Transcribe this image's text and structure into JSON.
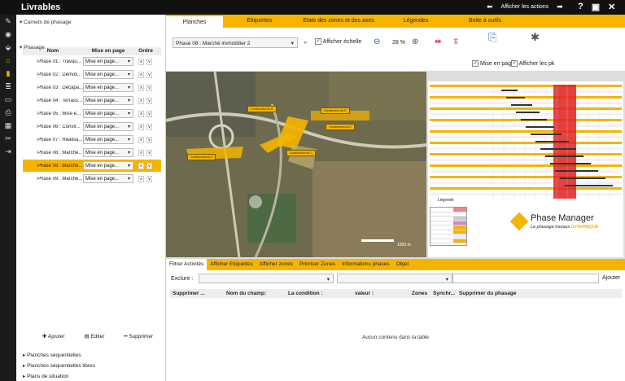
{
  "app": {
    "title": "Livrables",
    "show_actions": "Afficher les actions"
  },
  "panel": {
    "section_title": "Carnets de phasage",
    "columns": {
      "name": "Nom",
      "mode": "Mise en page",
      "order": "Ordre"
    },
    "group": "Phasage",
    "rows": [
      {
        "name": "Phase 01 : Travau...",
        "mode": "Mise en page..."
      },
      {
        "name": "Phase 02 : Démoli...",
        "mode": "Mise en page..."
      },
      {
        "name": "Phase 03 : Décapa...",
        "mode": "Mise en page..."
      },
      {
        "name": "Phase 04 : Terrass...",
        "mode": "Mise en page..."
      },
      {
        "name": "Phase 05 : Mise e...",
        "mode": "Mise en page..."
      },
      {
        "name": "Phase 06 : Constr...",
        "mode": "Mise en page..."
      },
      {
        "name": "Phase 07 : Réalisa...",
        "mode": "Mise en page..."
      },
      {
        "name": "Phase 08 : Marché...",
        "mode": "Mise en page..."
      },
      {
        "name": "Phase 08 : Marché...",
        "mode": "Mise en page..."
      },
      {
        "name": "Phase 09 : Marché...",
        "mode": "Mise en page..."
      }
    ],
    "buttons": {
      "add": "Ajouter",
      "edit": "Editer",
      "delete": "Supprimer"
    },
    "tree": [
      "Planches séquentielles",
      "Planches séquentielles libres",
      "Plans de situation"
    ]
  },
  "tabs": [
    "Planches",
    "Etiquettes",
    "Etats des zones et des axes",
    "Légendes",
    "Boite à outils"
  ],
  "toolbar": {
    "select_value": "Phase 08 : Marché immobilier 2",
    "show_scale": "Afficher échelle",
    "zoom": "28 %",
    "layout": "Mise en page",
    "show_pk": "Afficher les pk"
  },
  "sheet": {
    "legend_title": "Légende",
    "brand": "Phase Manager",
    "tagline_a": "Le phasage travaux",
    "tagline_b": "DYNAMIQUE",
    "scale_label": "1000 m"
  },
  "map_labels": [
    "Construction lot B",
    "Construction lot D",
    "Construction lot C",
    "Construction lot A",
    "Construction lot E"
  ],
  "lower_tabs": [
    "Filtrer Activités",
    "Afficher Etiquettes",
    "Afficher zones",
    "Prioriser Zones",
    "Informations phases",
    "Objet"
  ],
  "filter": {
    "exclude_label": "Exclure :",
    "apply": "Ajouter"
  },
  "table": {
    "columns": [
      "Supprimer ...",
      "Nom du champ:",
      "La condition :",
      "valeur :",
      "Zones",
      "Synchr...",
      "Supprimer du phasage"
    ],
    "empty": "Aucun contenu dans la table"
  },
  "colors": {
    "accent": "#f5b400",
    "dark": "#111111"
  }
}
